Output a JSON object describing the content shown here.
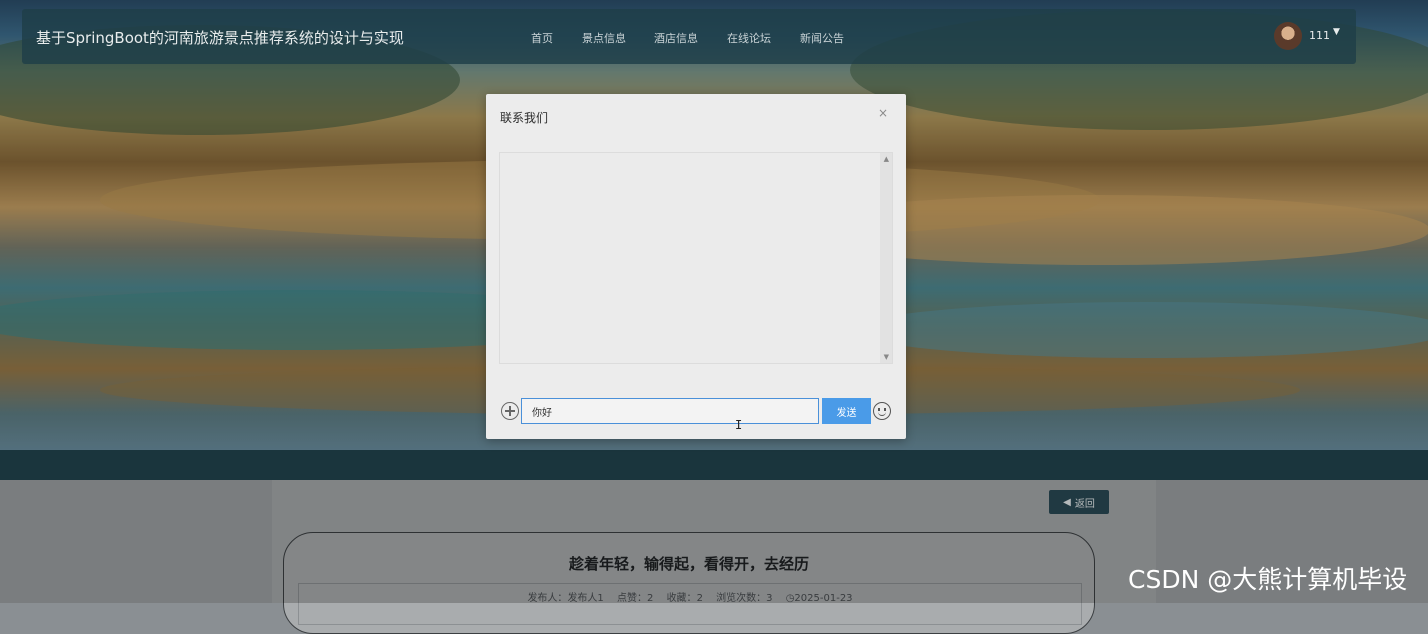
{
  "header": {
    "site_title": "基于SpringBoot的河南旅游景点推荐系统的设计与实现",
    "nav": [
      "首页",
      "景点信息",
      "酒店信息",
      "在线论坛",
      "新闻公告"
    ],
    "user_name": "111",
    "caret": "▼"
  },
  "modal": {
    "title": "联系我们",
    "close": "×",
    "input_value": "你好",
    "send_label": "发送",
    "scroll_up": "▲",
    "scroll_down": "▼"
  },
  "article": {
    "back_label": "返回",
    "back_icon": "◀",
    "title": "趁着年轻，输得起，看得开，去经历",
    "meta": {
      "publisher_label": "发布人：",
      "publisher": "发布人1",
      "likes_label": "点赞：",
      "likes": "2",
      "favorites_label": "收藏：",
      "favorites": "2",
      "views_label": "浏览次数：",
      "views": "3",
      "clock_icon": "◷",
      "date": "2025-01-23"
    }
  },
  "watermark": "CSDN @大熊计算机毕设",
  "cursor_glyph": "I"
}
